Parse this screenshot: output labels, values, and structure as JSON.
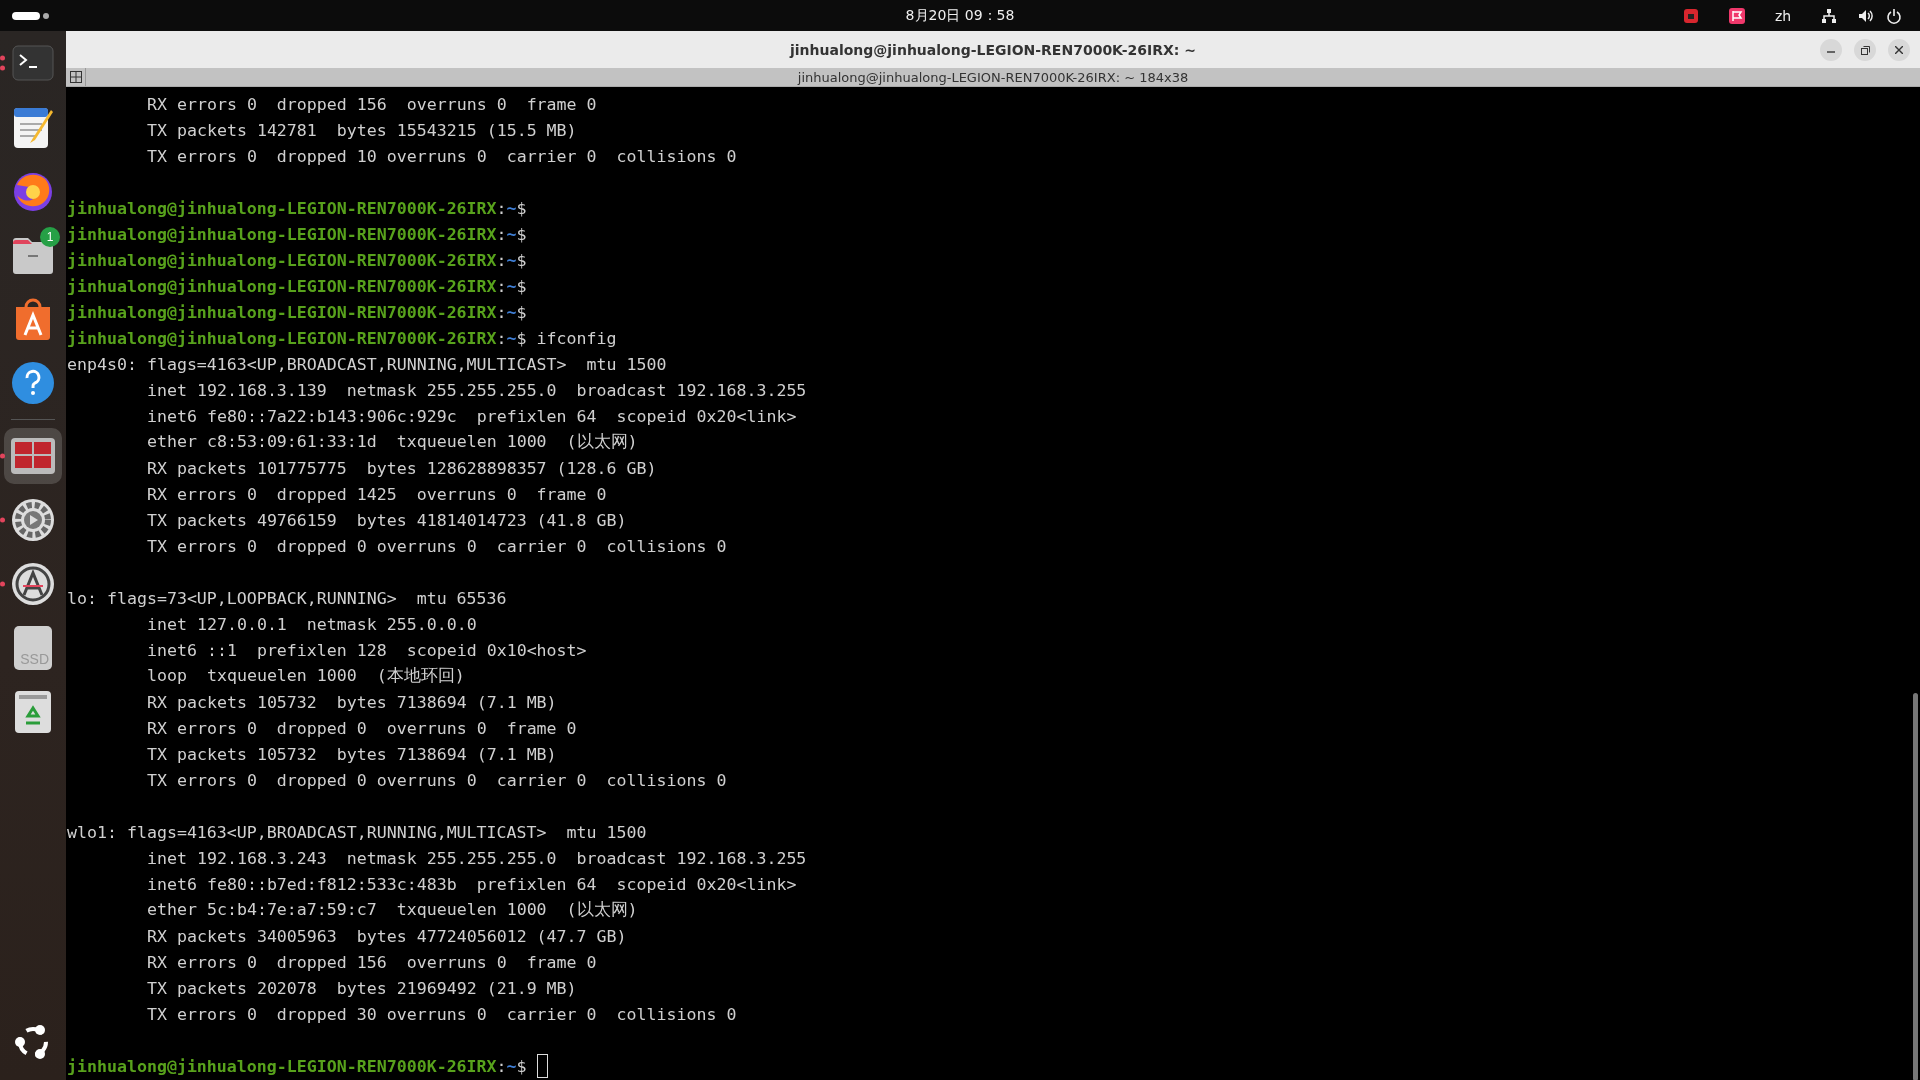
{
  "top_bar": {
    "clock": "8月20日  09：58",
    "language": "zh"
  },
  "dock": {
    "items": [
      {
        "kind": "terminal",
        "selected": false,
        "running": true,
        "multiple_windows": true
      },
      {
        "kind": "editor",
        "selected": false,
        "running": false,
        "multiple_windows": false
      },
      {
        "kind": "browser",
        "selected": false,
        "running": false,
        "multiple_windows": false
      },
      {
        "kind": "files",
        "selected": false,
        "running": false,
        "multiple_windows": false,
        "badge": "1"
      },
      {
        "kind": "store",
        "selected": false,
        "running": false,
        "multiple_windows": false
      },
      {
        "kind": "help",
        "selected": false,
        "running": false,
        "multiple_windows": false
      },
      {
        "kind": "monitor",
        "selected": true,
        "running": true,
        "multiple_windows": false
      },
      {
        "kind": "settings",
        "selected": false,
        "running": true,
        "multiple_windows": false
      },
      {
        "kind": "updater",
        "selected": false,
        "running": true,
        "multiple_windows": false
      },
      {
        "kind": "drive",
        "selected": false,
        "running": false,
        "multiple_windows": false,
        "label": "SSD"
      },
      {
        "kind": "trash",
        "selected": false,
        "running": false,
        "multiple_windows": false
      }
    ]
  },
  "window": {
    "title": "jinhualong@jinhualong-LEGION-REN7000K-26IRX: ~",
    "tab_title": "jinhualong@jinhualong-LEGION-REN7000K-26IRX: ~ 184x38"
  },
  "terminal": {
    "lines": [
      {
        "kind": "detail",
        "text": "RX errors 0  dropped 156  overruns 0  frame 0"
      },
      {
        "kind": "detail",
        "text": "TX packets 142781  bytes 15543215 (15.5 MB)"
      },
      {
        "kind": "detail",
        "text": "TX errors 0  dropped 10 overruns 0  carrier 0  collisions 0"
      },
      {
        "kind": "blank"
      },
      {
        "kind": "prompt",
        "user": "jinhualong@jinhualong-LEGION-REN7000K-26IRX",
        "colon": ":",
        "path": "~",
        "symbol": "$"
      },
      {
        "kind": "prompt",
        "user": "jinhualong@jinhualong-LEGION-REN7000K-26IRX",
        "colon": ":",
        "path": "~",
        "symbol": "$"
      },
      {
        "kind": "prompt",
        "user": "jinhualong@jinhualong-LEGION-REN7000K-26IRX",
        "colon": ":",
        "path": "~",
        "symbol": "$"
      },
      {
        "kind": "prompt",
        "user": "jinhualong@jinhualong-LEGION-REN7000K-26IRX",
        "colon": ":",
        "path": "~",
        "symbol": "$"
      },
      {
        "kind": "prompt",
        "user": "jinhualong@jinhualong-LEGION-REN7000K-26IRX",
        "colon": ":",
        "path": "~",
        "symbol": "$"
      },
      {
        "kind": "prompt",
        "user": "jinhualong@jinhualong-LEGION-REN7000K-26IRX",
        "colon": ":",
        "path": "~",
        "symbol": "$",
        "command": "ifconfig"
      },
      {
        "kind": "header",
        "text": "enp4s0: flags=4163<UP,BROADCAST,RUNNING,MULTICAST>  mtu 1500"
      },
      {
        "kind": "detail",
        "text": "inet 192.168.3.139  netmask 255.255.255.0  broadcast 192.168.3.255"
      },
      {
        "kind": "detail",
        "text": "inet6 fe80::7a22:b143:906c:929c  prefixlen 64  scopeid 0x20<link>"
      },
      {
        "kind": "detail",
        "text": "ether c8:53:09:61:33:1d  txqueuelen 1000  (以太网)"
      },
      {
        "kind": "detail",
        "text": "RX packets 101775775  bytes 128628898357 (128.6 GB)"
      },
      {
        "kind": "detail",
        "text": "RX errors 0  dropped 1425  overruns 0  frame 0"
      },
      {
        "kind": "detail",
        "text": "TX packets 49766159  bytes 41814014723 (41.8 GB)"
      },
      {
        "kind": "detail",
        "text": "TX errors 0  dropped 0 overruns 0  carrier 0  collisions 0"
      },
      {
        "kind": "blank"
      },
      {
        "kind": "header",
        "text": "lo: flags=73<UP,LOOPBACK,RUNNING>  mtu 65536"
      },
      {
        "kind": "detail",
        "text": "inet 127.0.0.1  netmask 255.0.0.0"
      },
      {
        "kind": "detail",
        "text": "inet6 ::1  prefixlen 128  scopeid 0x10<host>"
      },
      {
        "kind": "detail",
        "text": "loop  txqueuelen 1000  (本地环回)"
      },
      {
        "kind": "detail",
        "text": "RX packets 105732  bytes 7138694 (7.1 MB)"
      },
      {
        "kind": "detail",
        "text": "RX errors 0  dropped 0  overruns 0  frame 0"
      },
      {
        "kind": "detail",
        "text": "TX packets 105732  bytes 7138694 (7.1 MB)"
      },
      {
        "kind": "detail",
        "text": "TX errors 0  dropped 0 overruns 0  carrier 0  collisions 0"
      },
      {
        "kind": "blank"
      },
      {
        "kind": "header",
        "text": "wlo1: flags=4163<UP,BROADCAST,RUNNING,MULTICAST>  mtu 1500"
      },
      {
        "kind": "detail",
        "text": "inet 192.168.3.243  netmask 255.255.255.0  broadcast 192.168.3.255"
      },
      {
        "kind": "detail",
        "text": "inet6 fe80::b7ed:f812:533c:483b  prefixlen 64  scopeid 0x20<link>"
      },
      {
        "kind": "detail",
        "text": "ether 5c:b4:7e:a7:59:c7  txqueuelen 1000  (以太网)"
      },
      {
        "kind": "detail",
        "text": "RX packets 34005963  bytes 47724056012 (47.7 GB)"
      },
      {
        "kind": "detail",
        "text": "RX errors 0  dropped 156  overruns 0  frame 0"
      },
      {
        "kind": "detail",
        "text": "TX packets 202078  bytes 21969492 (21.9 MB)"
      },
      {
        "kind": "detail",
        "text": "TX errors 0  dropped 30 overruns 0  carrier 0  collisions 0"
      },
      {
        "kind": "blank"
      },
      {
        "kind": "prompt",
        "user": "jinhualong@jinhualong-LEGION-REN7000K-26IRX",
        "colon": ":",
        "path": "~",
        "symbol": "$",
        "cursor": true
      }
    ]
  }
}
